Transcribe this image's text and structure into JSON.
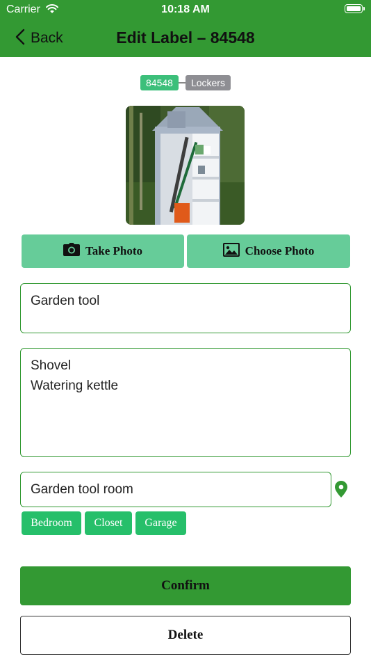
{
  "status_bar": {
    "carrier": "Carrier",
    "time": "10:18 AM"
  },
  "nav": {
    "back_label": "Back",
    "title": "Edit Label – 84548"
  },
  "label_tags": {
    "id": "84548",
    "category": "Lockers"
  },
  "photo": {
    "subject": "garden tool shed photo"
  },
  "photo_buttons": {
    "take": "Take Photo",
    "choose": "Choose Photo"
  },
  "form": {
    "name": "Garden tool",
    "contents_lines": [
      "Shovel",
      "Watering kettle"
    ],
    "location": "Garden tool room"
  },
  "location_suggestions": [
    "Bedroom",
    "Closet",
    "Garage"
  ],
  "actions": {
    "confirm": "Confirm",
    "delete": "Delete"
  },
  "colors": {
    "primary": "#339933",
    "photo_button": "#66cc99",
    "chip": "#26bf6a",
    "tag_id": "#3cbf7a",
    "tag_category": "#8e8e93"
  }
}
